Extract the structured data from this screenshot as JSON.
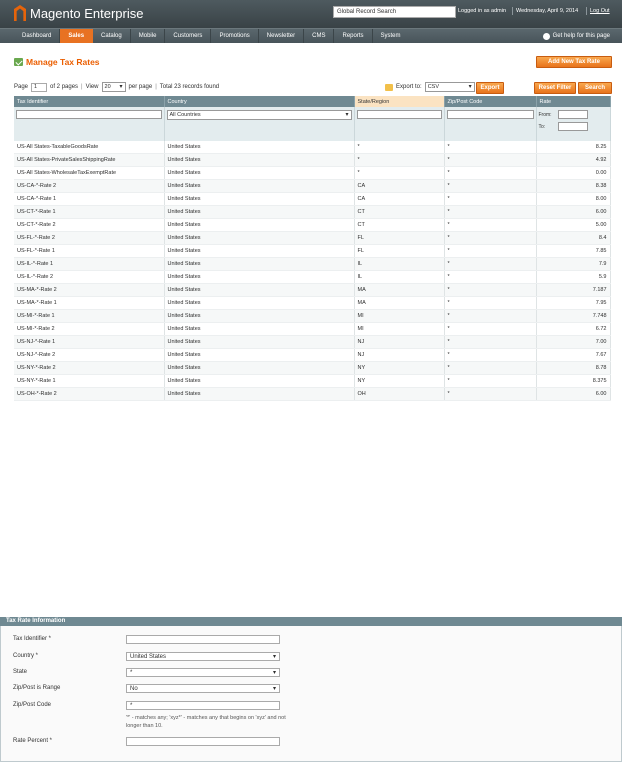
{
  "header": {
    "logo_text": "Magento Enterprise",
    "search_placeholder": "Global Record Search",
    "logged_in": "Logged in as admin",
    "date": "Wednesday, April 9, 2014",
    "logout": "Log Out"
  },
  "nav": {
    "items": [
      "Dashboard",
      "Sales",
      "Catalog",
      "Mobile",
      "Customers",
      "Promotions",
      "Newsletter",
      "CMS",
      "Reports",
      "System"
    ],
    "active": "Sales",
    "help": "Get help for this page"
  },
  "page": {
    "title": "Manage Tax Rates",
    "add_button": "Add New Tax Rate",
    "reset_button": "Reset Filter",
    "search_button": "Search"
  },
  "pager": {
    "page_label": "Page",
    "page_value": "1",
    "of_pages": "of 2 pages",
    "view_label": "View",
    "per_page_value": "20",
    "per_page_label": "per page",
    "records": "Total 23 records found",
    "export_label": "Export to:",
    "export_format": "CSV",
    "export_button": "Export"
  },
  "grid": {
    "columns": [
      "Tax Identifier",
      "Country",
      "State/Region",
      "Zip/Post Code",
      "Rate"
    ],
    "filter_country": "All Countries",
    "rate_from": "From:",
    "rate_to": "To:",
    "rows": [
      [
        "US-All States-TaxableGoodsRate",
        "United States",
        "*",
        "*",
        "8.25"
      ],
      [
        "US-All States-PrivateSalesShippingRate",
        "United States",
        "*",
        "*",
        "4.92"
      ],
      [
        "US-All States-WholesaleTaxExemptRate",
        "United States",
        "*",
        "*",
        "0.00"
      ],
      [
        "US-CA-*-Rate 2",
        "United States",
        "CA",
        "*",
        "8.38"
      ],
      [
        "US-CA-*-Rate 1",
        "United States",
        "CA",
        "*",
        "8.00"
      ],
      [
        "US-CT-*-Rate 1",
        "United States",
        "CT",
        "*",
        "6.00"
      ],
      [
        "US-CT-*-Rate 2",
        "United States",
        "CT",
        "*",
        "5.00"
      ],
      [
        "US-FL-*-Rate 2",
        "United States",
        "FL",
        "*",
        "8.4"
      ],
      [
        "US-FL-*-Rate 1",
        "United States",
        "FL",
        "*",
        "7.85"
      ],
      [
        "US-IL-*-Rate 1",
        "United States",
        "IL",
        "*",
        "7.9"
      ],
      [
        "US-IL-*-Rate 2",
        "United States",
        "IL",
        "*",
        "5.9"
      ],
      [
        "US-MA-*-Rate 2",
        "United States",
        "MA",
        "*",
        "7.187"
      ],
      [
        "US-MA-*-Rate 1",
        "United States",
        "MA",
        "*",
        "7.95"
      ],
      [
        "US-MI-*-Rate 1",
        "United States",
        "MI",
        "*",
        "7.748"
      ],
      [
        "US-MI-*-Rate 2",
        "United States",
        "MI",
        "*",
        "6.72"
      ],
      [
        "US-NJ-*-Rate 1",
        "United States",
        "NJ",
        "*",
        "7.00"
      ],
      [
        "US-NJ-*-Rate 2",
        "United States",
        "NJ",
        "*",
        "7.67"
      ],
      [
        "US-NY-*-Rate 2",
        "United States",
        "NY",
        "*",
        "8.78"
      ],
      [
        "US-NY-*-Rate 1",
        "United States",
        "NY",
        "*",
        "8.375"
      ],
      [
        "US-OH-*-Rate 2",
        "United States",
        "OH",
        "*",
        "6.00"
      ]
    ]
  },
  "form": {
    "section_title": "Tax Rate Information",
    "tax_identifier_label": "Tax Identifier *",
    "country_label": "Country *",
    "country_value": "United States",
    "state_label": "State",
    "state_value": "*",
    "zip_range_label": "Zip/Post is Range",
    "zip_range_value": "No",
    "zip_label": "Zip/Post Code",
    "zip_value": "*",
    "zip_note": "'*' - matches any; 'xyz*' - matches any that begins on 'xyz' and not longer than 10.",
    "rate_label": "Rate Percent *"
  },
  "colors": {
    "accent": "#e87222",
    "header": "#394246",
    "grid_header": "#6f8992"
  }
}
